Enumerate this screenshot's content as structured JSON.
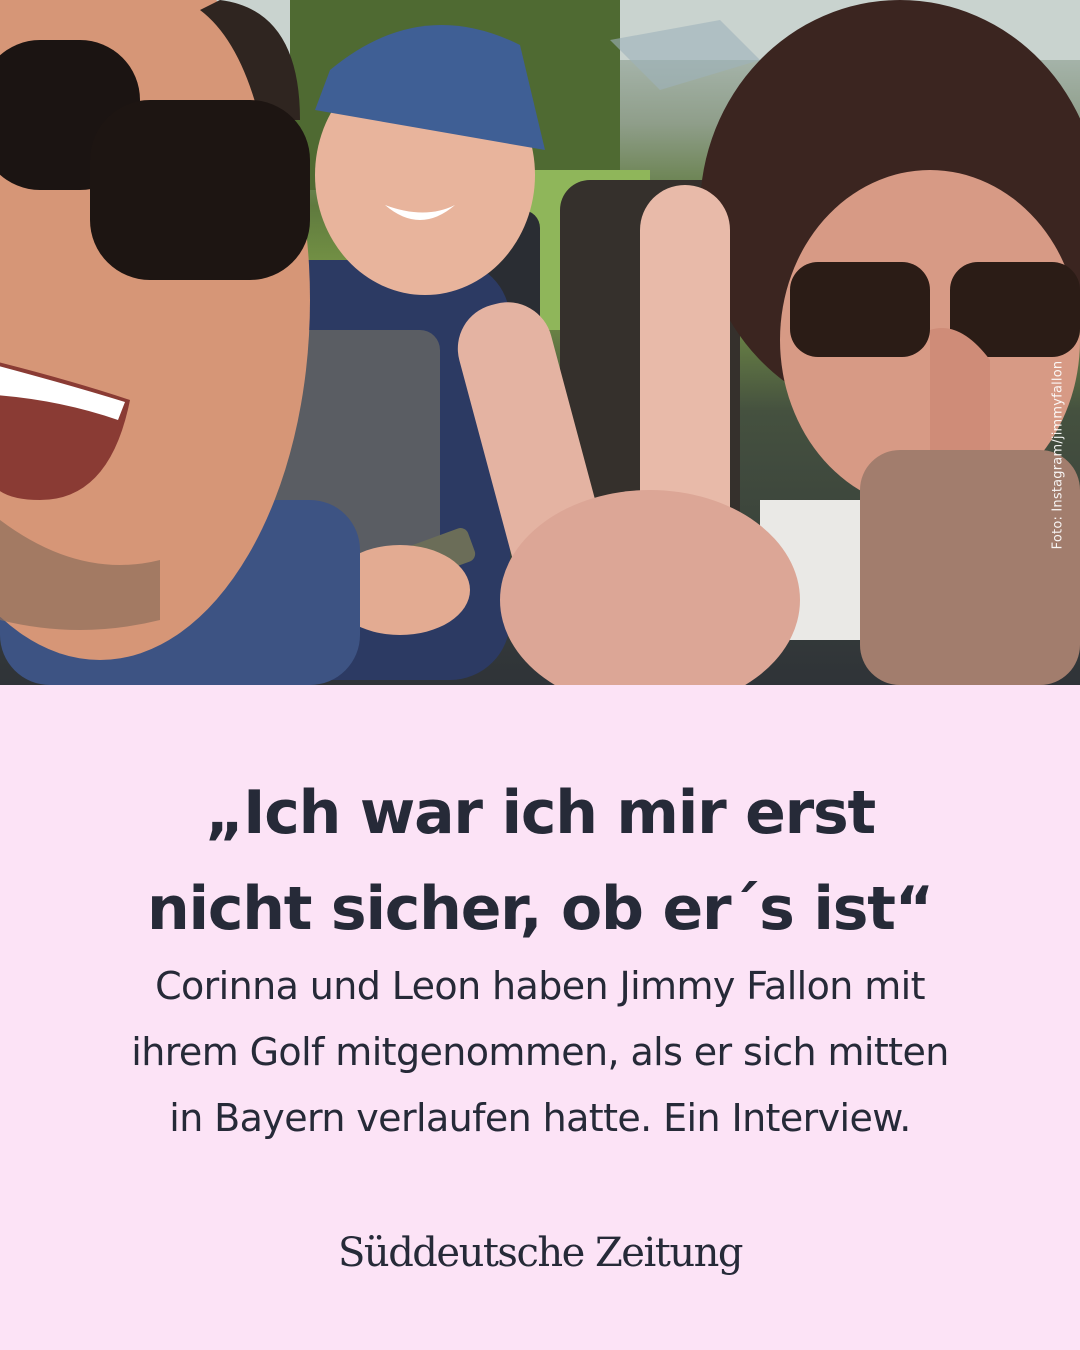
{
  "photo": {
    "credit": "Foto: Instagram/jimmyfallon"
  },
  "headline": {
    "line1": "„Ich war ich mir erst",
    "line2": "nicht sicher, ob er´s ist“"
  },
  "subline": {
    "line1": "Corinna und Leon haben Jimmy Fallon mit",
    "line2": "ihrem Golf mitgenommen, als er sich mitten",
    "line3": "in Bayern verlaufen hatte. Ein Interview."
  },
  "brand": {
    "logo_text": "Süddeutsche Zeitung"
  },
  "colors": {
    "panel_background": "#fce3f6",
    "text": "#262a38"
  }
}
